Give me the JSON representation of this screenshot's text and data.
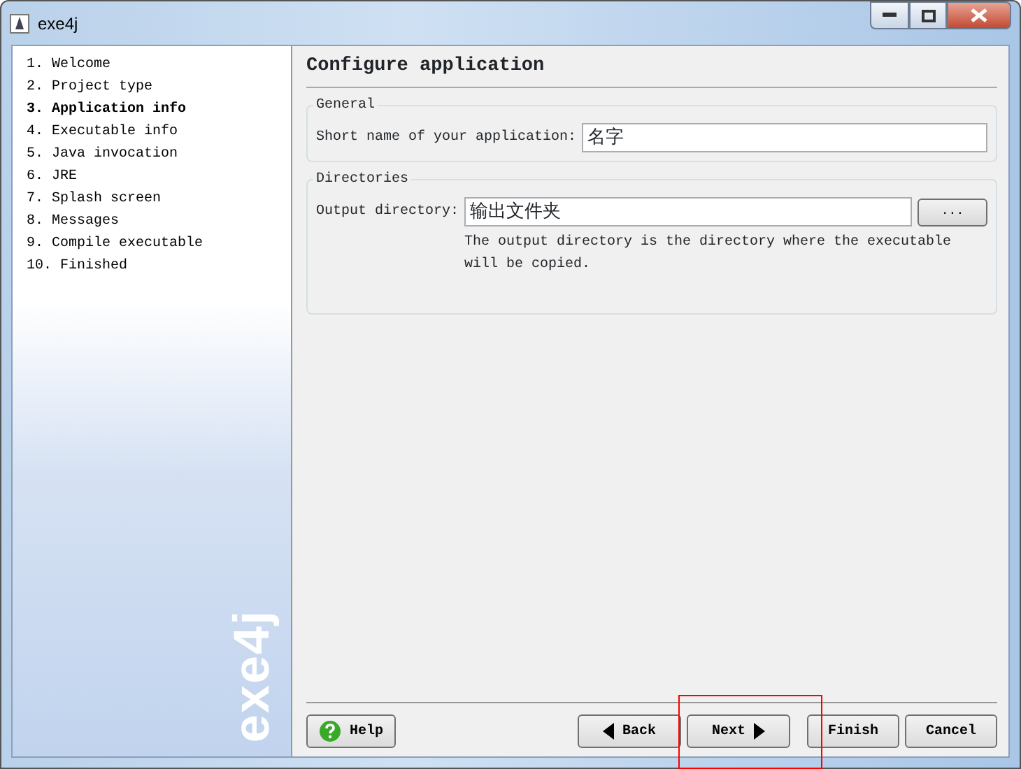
{
  "window": {
    "title": "exe4j"
  },
  "steps": [
    {
      "label": "1. Welcome",
      "selected": false
    },
    {
      "label": "2. Project type",
      "selected": false
    },
    {
      "label": "3. Application info",
      "selected": true
    },
    {
      "label": "4. Executable info",
      "selected": false
    },
    {
      "label": "5. Java invocation",
      "selected": false
    },
    {
      "label": "6. JRE",
      "selected": false
    },
    {
      "label": "7. Splash screen",
      "selected": false
    },
    {
      "label": "8. Messages",
      "selected": false
    },
    {
      "label": "9. Compile executable",
      "selected": false
    },
    {
      "label": "10. Finished",
      "selected": false
    }
  ],
  "sidebar_logo": "exe4j",
  "page_title": "Configure application",
  "general": {
    "title": "General",
    "label": "Short name of your application:",
    "value": "名字"
  },
  "directories": {
    "title": "Directories",
    "label": "Output directory:",
    "value": "输出文件夹",
    "browse": "...",
    "hint": "The output directory is the directory where the executable will be copied."
  },
  "buttons": {
    "help": "Help",
    "back": "Back",
    "next": "Next",
    "finish": "Finish",
    "cancel": "Cancel"
  }
}
